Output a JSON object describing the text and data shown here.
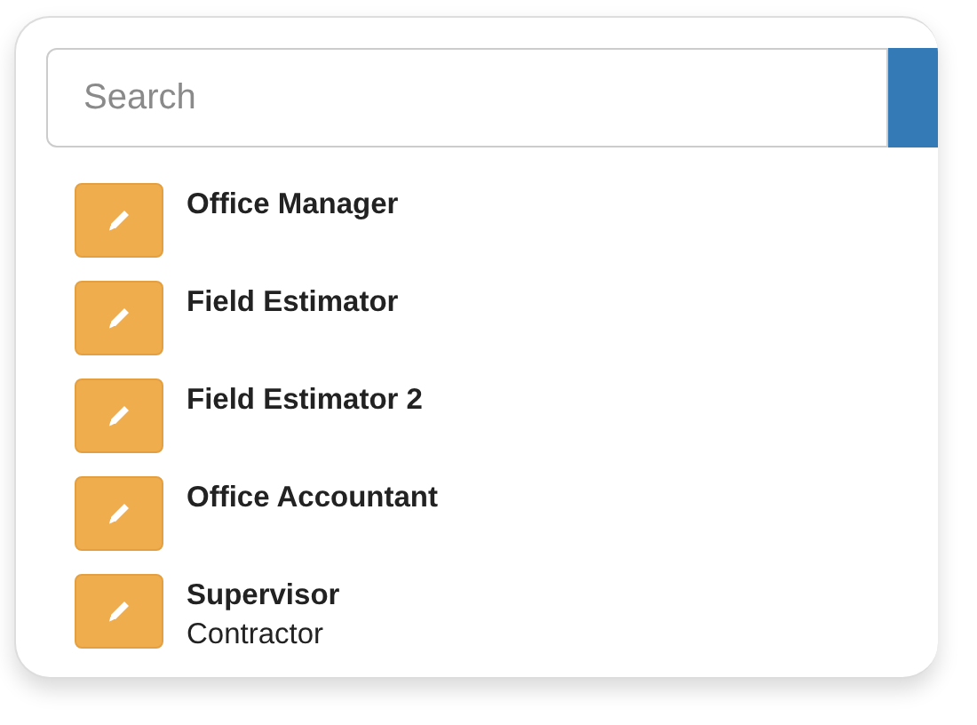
{
  "search": {
    "placeholder": "Search"
  },
  "items": [
    {
      "title": "Office Manager"
    },
    {
      "title": "Field Estimator"
    },
    {
      "title": "Field Estimator 2"
    },
    {
      "title": "Office Accountant"
    },
    {
      "title": "Supervisor",
      "subtitle": "Contractor"
    }
  ]
}
